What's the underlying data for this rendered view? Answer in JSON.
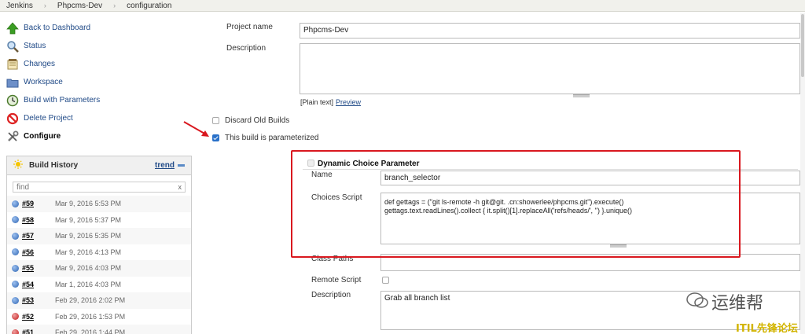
{
  "breadcrumb": [
    "Jenkins",
    "Phpcms-Dev",
    "configuration"
  ],
  "sidebar": {
    "items": [
      {
        "label": "Back to Dashboard",
        "icon": "up-arrow-icon"
      },
      {
        "label": "Status",
        "icon": "search-icon"
      },
      {
        "label": "Changes",
        "icon": "notepad-icon"
      },
      {
        "label": "Workspace",
        "icon": "folder-icon"
      },
      {
        "label": "Build with Parameters",
        "icon": "clock-icon"
      },
      {
        "label": "Delete Project",
        "icon": "no-icon"
      },
      {
        "label": "Configure",
        "icon": "wrench-icon"
      }
    ]
  },
  "build_history": {
    "title": "Build History",
    "trend_label": "trend",
    "filter_placeholder": "find",
    "clear_label": "x",
    "builds": [
      {
        "num": "#59",
        "date": "Mar 9, 2016 5:53 PM",
        "status": "blue"
      },
      {
        "num": "#58",
        "date": "Mar 9, 2016 5:37 PM",
        "status": "blue"
      },
      {
        "num": "#57",
        "date": "Mar 9, 2016 5:35 PM",
        "status": "blue"
      },
      {
        "num": "#56",
        "date": "Mar 9, 2016 4:13 PM",
        "status": "blue"
      },
      {
        "num": "#55",
        "date": "Mar 9, 2016 4:03 PM",
        "status": "blue"
      },
      {
        "num": "#54",
        "date": "Mar 1, 2016 4:03 PM",
        "status": "blue"
      },
      {
        "num": "#53",
        "date": "Feb 29, 2016 2:02 PM",
        "status": "blue"
      },
      {
        "num": "#52",
        "date": "Feb 29, 2016 1:53 PM",
        "status": "red"
      },
      {
        "num": "#51",
        "date": "Feb 29, 2016 1:44 PM",
        "status": "red"
      }
    ]
  },
  "form": {
    "project_name_label": "Project name",
    "project_name_value": "Phpcms-Dev",
    "description_label": "Description",
    "description_value": "",
    "plain_text_label": "[Plain text]",
    "preview_label": "Preview",
    "discard_label": "Discard Old Builds",
    "parameterized_label": "This build is parameterized",
    "param": {
      "title": "Dynamic Choice Parameter",
      "name_label": "Name",
      "name_value": "branch_selector",
      "script_label": "Choices Script",
      "script_line1": "def gettags = (\"git ls-remote -h git@git.                 .cn:showerlee/phpcms.git\").execute()",
      "script_line2": "gettags.text.readLines().collect { it.split()[1].replaceAll('refs/heads/', '')  }.unique()",
      "classpaths_label": "Class Paths",
      "remote_label": "Remote Script",
      "desc_label": "Description",
      "desc_value": "Grab all branch list"
    }
  },
  "watermark": {
    "line1": "运维帮",
    "line2": "ITIL先锋论坛"
  },
  "colors": {
    "accent_red": "#d9181f",
    "link": "#204a87",
    "checkbox": "#2a71c9"
  }
}
